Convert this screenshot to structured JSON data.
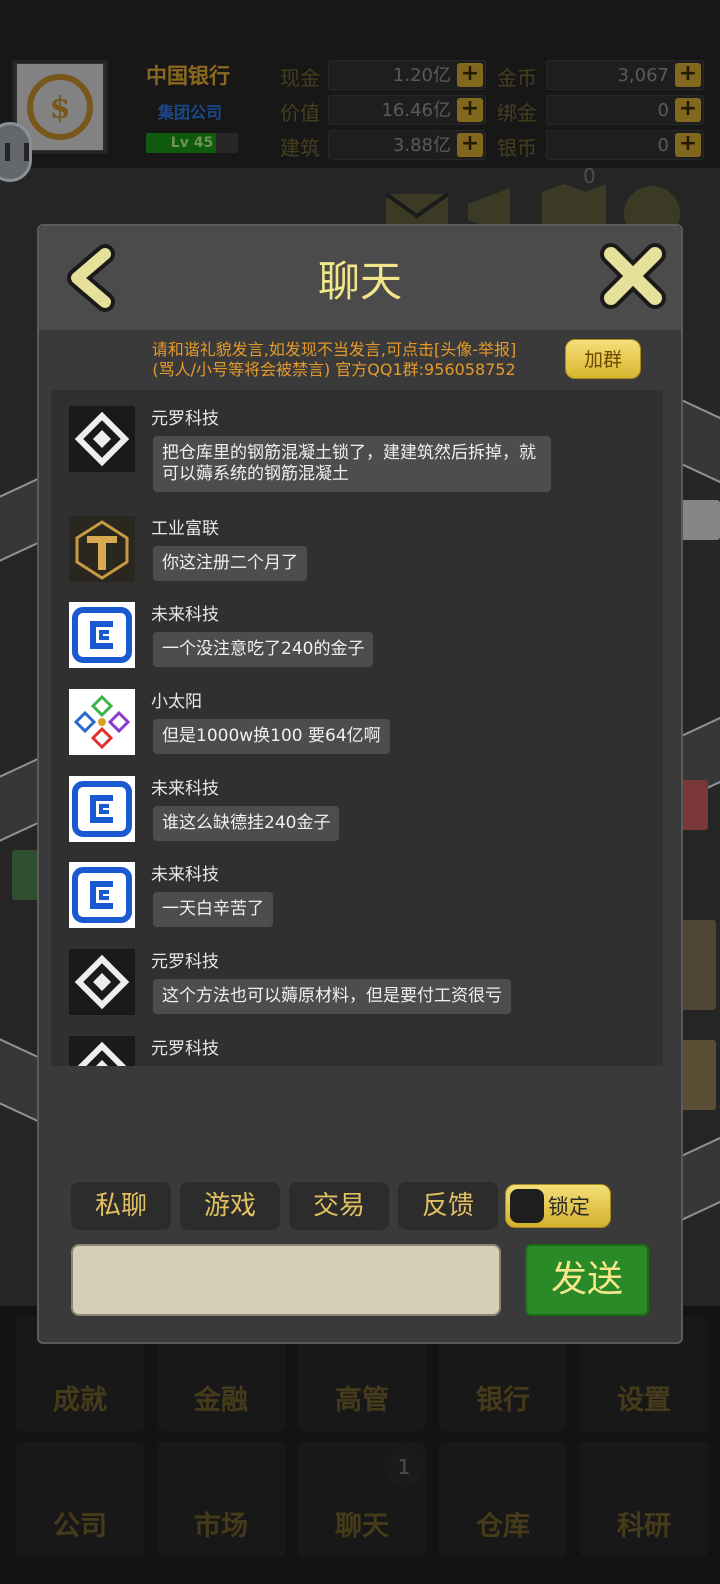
{
  "header": {
    "company_name": "中国银行",
    "company_type": "集团公司",
    "level": "Lv 45",
    "level_progress": 0.76
  },
  "stats": [
    {
      "label": "现金",
      "value": "1.20亿"
    },
    {
      "label": "价值",
      "value": "16.46亿"
    },
    {
      "label": "建筑",
      "value": "3.88亿"
    },
    {
      "label": "金币",
      "value": "3,067"
    },
    {
      "label": "绑金",
      "value": "0"
    },
    {
      "label": "银币",
      "value": "0"
    }
  ],
  "top_badge": "0",
  "dialog": {
    "title": "聊天",
    "notice_line1": "请和谐礼貌发言,如发现不当发言,可点击[头像-举报]",
    "notice_line2": "(骂人/小号等将会被禁言) 官方QQ1群:956058752",
    "join_label": "加群"
  },
  "messages": [
    {
      "sender": "元罗科技",
      "text": "把仓库里的钢筋混凝土锁了，建建筑然后拆掉，就可以薅系统的钢筋混凝土",
      "avatar": "diamond-logo"
    },
    {
      "sender": "工业富联",
      "text": "你这注册二个月了",
      "avatar": "gold-t-logo"
    },
    {
      "sender": "未来科技",
      "text": "一个没注意吃了240的金子",
      "avatar": "blue-c-logo"
    },
    {
      "sender": "小太阳",
      "text": "但是1000w换100 要64亿啊",
      "avatar": "colorful-pattern-logo"
    },
    {
      "sender": "未来科技",
      "text": "谁这么缺德挂240金子",
      "avatar": "blue-c-logo"
    },
    {
      "sender": "未来科技",
      "text": "一天白辛苦了",
      "avatar": "blue-c-logo"
    },
    {
      "sender": "元罗科技",
      "text": "这个方法也可以薅原材料，但是要付工资很亏",
      "avatar": "diamond-logo"
    },
    {
      "sender": "元罗科技",
      "text": "",
      "avatar": "diamond-logo"
    }
  ],
  "chat_tabs": [
    "私聊",
    "游戏",
    "交易",
    "反馈"
  ],
  "lock_label": "锁定",
  "send_label": "发送",
  "input_placeholder": "",
  "bottom_menu": [
    "成就",
    "金融",
    "高管",
    "银行",
    "设置",
    "公司",
    "市场",
    "聊天",
    "仓库",
    "科研"
  ],
  "chat_notification_count": "1",
  "colors": {
    "accent_yellow": "#f2e68a",
    "send_green": "#2a8a28",
    "notice_orange": "#e49a2a"
  }
}
